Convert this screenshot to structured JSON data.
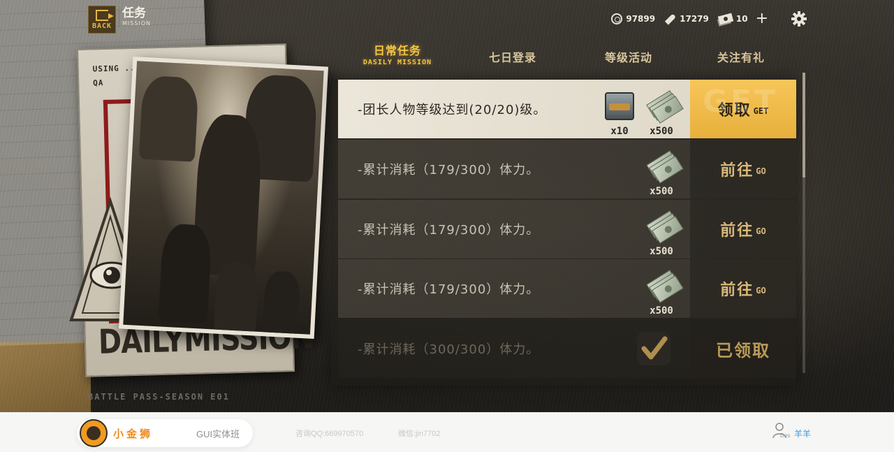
{
  "header": {
    "back_label": "BACK",
    "title_cn": "任务",
    "title_en": "MISSION"
  },
  "resources": {
    "coins": "97899",
    "bullets": "17279",
    "cash": "10",
    "plus": "+"
  },
  "tabs": [
    {
      "label": "日常任务",
      "sublabel": "DASILY MISSION",
      "active": true
    },
    {
      "label": "七日登录",
      "active": false
    },
    {
      "label": "等级活动",
      "active": false
    },
    {
      "label": "关注有礼",
      "active": false
    }
  ],
  "missions": [
    {
      "desc": "-团长人物等级达到(20/20)级。",
      "rewards": [
        {
          "icon": "chest-icon",
          "count": "x10"
        },
        {
          "icon": "cash-icon",
          "count": "x500"
        }
      ],
      "action_cn": "领取",
      "action_en": "GET",
      "state": "claimable",
      "ghost": "GET"
    },
    {
      "desc": "-累计消耗（179/300）体力。",
      "rewards": [
        {
          "icon": "cash-icon",
          "count": "x500"
        }
      ],
      "action_cn": "前往",
      "action_en": "GO",
      "state": "go"
    },
    {
      "desc": "-累计消耗（179/300）体力。",
      "rewards": [
        {
          "icon": "cash-icon",
          "count": "x500"
        }
      ],
      "action_cn": "前往",
      "action_en": "GO",
      "state": "go"
    },
    {
      "desc": "-累计消耗（179/300）体力。",
      "rewards": [
        {
          "icon": "cash-icon",
          "count": "x500"
        }
      ],
      "action_cn": "前往",
      "action_en": "GO",
      "state": "go"
    },
    {
      "desc": "-累计消耗（300/300）体力。",
      "rewards": [
        {
          "icon": "check-icon"
        }
      ],
      "action_cn": "已领取",
      "state": "claimed"
    }
  ],
  "poster": {
    "card_text": "USING ... AND HUNTING KNIFE. QA",
    "daily_mission": "DAILYMISSION",
    "season": "BATTLE PASS-SEASON E01"
  },
  "footer": {
    "brand_name": "小金狮",
    "brand_class": "GUI实体班",
    "qq": "咨询QQ:669970570",
    "wechat": "微信:jin7702",
    "user_des": "Des",
    "user_name": "羊羊"
  },
  "colors": {
    "accent_gold": "#f5c542",
    "claim_button": "#f7c659",
    "brand_orange": "#f08a1a",
    "user_blue": "#3a9ee6"
  }
}
